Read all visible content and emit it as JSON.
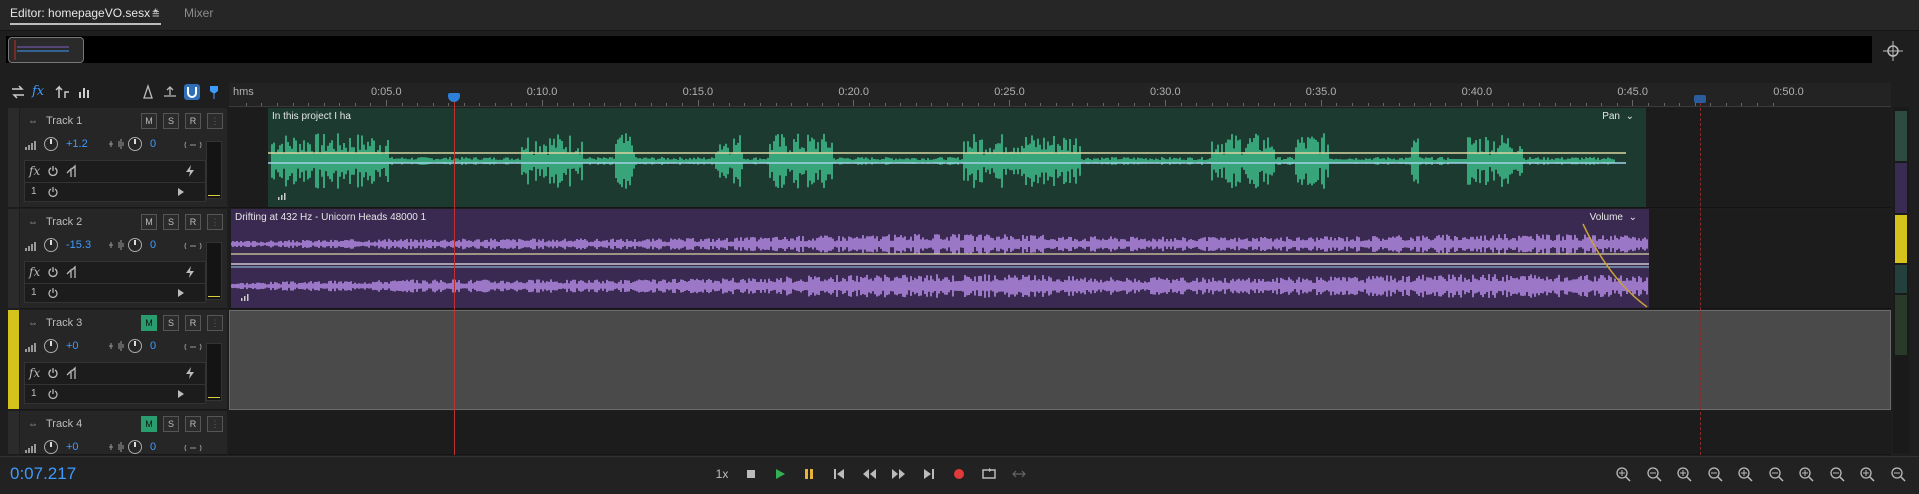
{
  "tabs": {
    "editor_label": "Editor: homepageVO.sesx *",
    "menu_glyph": "≡",
    "mixer_label": "Mixer"
  },
  "ruler": {
    "unit": "hms",
    "ticks": [
      "0:05.0",
      "0:10.0",
      "0:15.0",
      "0:20.0",
      "0:25.0",
      "0:30.0",
      "0:35.0",
      "0:40.0",
      "0:45.0",
      "0:50.0"
    ]
  },
  "tracks": [
    {
      "name": "Track 1",
      "volume": "+1.2",
      "pan": "0",
      "mute": false,
      "color": "#2a5a46",
      "fx_count": "1"
    },
    {
      "name": "Track 2",
      "volume": "-15.3",
      "pan": "0",
      "mute": false,
      "color": "#3a2b52",
      "fx_count": "1"
    },
    {
      "name": "Track 3",
      "volume": "+0",
      "pan": "0",
      "mute": true,
      "color": "#d6c21c",
      "fx_count": "1"
    },
    {
      "name": "Track 4",
      "volume": "+0",
      "pan": "0",
      "mute": true,
      "color": "#2a3a5a",
      "fx_count": ""
    }
  ],
  "track_buttons": {
    "m": "M",
    "s": "S",
    "r": "R",
    "i": "⋮",
    "fx": "fx"
  },
  "clips": [
    {
      "title": "In this project I ha",
      "envelope": "Pan",
      "envelope_caret": "⌄",
      "color": "#1c3a30",
      "wave": "#3fbf8e"
    },
    {
      "title": "Drifting at 432 Hz - Unicorn Heads 48000 1",
      "envelope": "Volume",
      "envelope_caret": "⌄",
      "color": "#3a2950",
      "wave": "#b48be6"
    }
  ],
  "transport": {
    "timecode": "0:07.217",
    "speed": "1x"
  },
  "icons": {
    "play": "play-icon",
    "stop": "stop-icon",
    "pause": "pause-icon",
    "record": "record-icon"
  },
  "colors": {
    "accent": "#3d9bff",
    "playhead": "#c0302f",
    "play": "#35b050",
    "pause": "#e8b33a",
    "record": "#e23a3a"
  }
}
